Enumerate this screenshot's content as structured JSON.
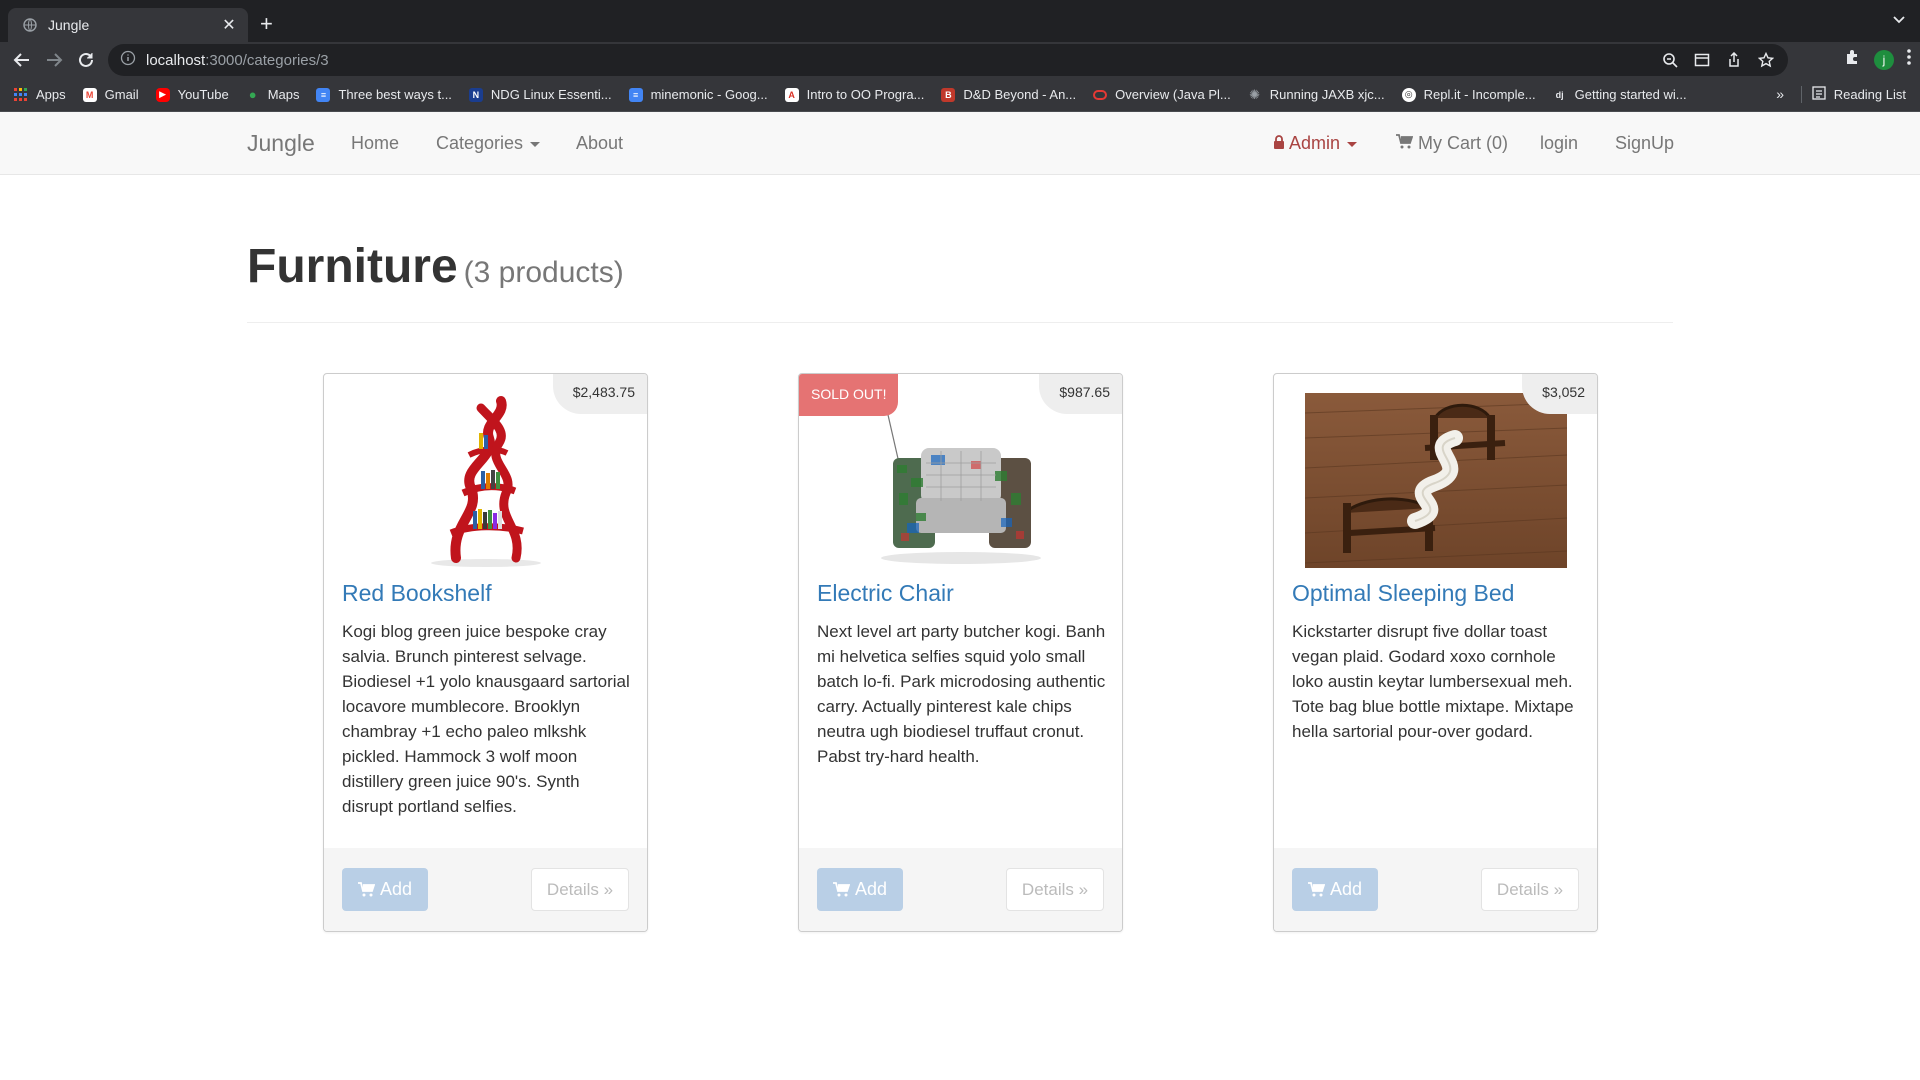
{
  "browser": {
    "tab_title": "Jungle",
    "url_host": "localhost",
    "url_path": ":3000/categories/3",
    "profile_initial": "j",
    "bookmarks": [
      {
        "label": "Apps",
        "color": "#4285f4"
      },
      {
        "label": "Gmail",
        "color": "#ea4335"
      },
      {
        "label": "YouTube",
        "color": "#ff0000"
      },
      {
        "label": "Maps",
        "color": "#34a853"
      },
      {
        "label": "Three best ways t...",
        "color": "#4285f4"
      },
      {
        "label": "NDG Linux Essenti...",
        "color": "#1a3d8f"
      },
      {
        "label": "minemonic - Goog...",
        "color": "#4285f4"
      },
      {
        "label": "Intro to OO Progra...",
        "color": "#d93025"
      },
      {
        "label": "D&D Beyond - An...",
        "color": "#c0392b"
      },
      {
        "label": "Overview (Java Pl...",
        "color": "#e53935"
      },
      {
        "label": "Running JAXB xjc...",
        "color": "#5f6368"
      },
      {
        "label": "Repl.it - Incomple...",
        "color": "#333333"
      },
      {
        "label": "Getting started wi...",
        "color": "#0c4b33"
      }
    ],
    "bookmarks_more": "»",
    "reading_list": "Reading List"
  },
  "nav": {
    "brand": "Jungle",
    "home": "Home",
    "categories": "Categories",
    "about": "About",
    "admin": "Admin",
    "cart": "My Cart (0)",
    "login": "login",
    "signup": "SignUp"
  },
  "page": {
    "title": "Furniture",
    "count": "(3 products)"
  },
  "products": [
    {
      "name": "Red Bookshelf",
      "price": "$2,483.75",
      "description": "Kogi blog green juice bespoke cray salvia. Brunch pinterest selvage. Biodiesel +1 yolo knausgaard sartorial locavore mumblecore. Brooklyn chambray +1 echo paleo mlkshk pickled. Hammock 3 wolf moon distillery green juice 90's. Synth disrupt portland selfies.",
      "add_label": "Add",
      "details_label": "Details »"
    },
    {
      "name": "Electric Chair",
      "price": "$987.65",
      "badge": "SOLD OUT!",
      "description": "Next level art party butcher kogi. Banh mi helvetica selfies squid yolo small batch lo-fi. Park microdosing authentic carry. Actually pinterest kale chips neutra ugh biodiesel truffaut cronut. Pabst try-hard health.",
      "add_label": "Add",
      "details_label": "Details »"
    },
    {
      "name": "Optimal Sleeping Bed",
      "price": "$3,052",
      "description": "Kickstarter disrupt five dollar toast vegan plaid. Godard xoxo cornhole loko austin keytar lumbersexual meh. Tote bag blue bottle mixtape. Mixtape hella sartorial pour-over godard.",
      "add_label": "Add",
      "details_label": "Details »"
    }
  ]
}
